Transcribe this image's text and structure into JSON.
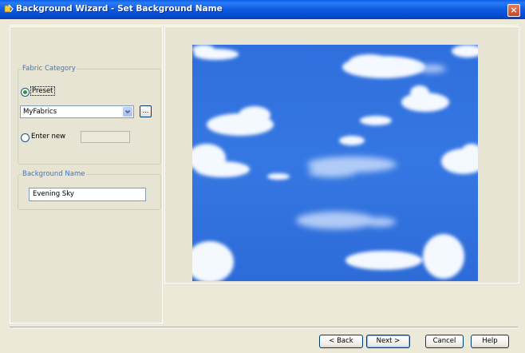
{
  "window": {
    "title": "Background Wizard - Set Background Name",
    "close_label": "×"
  },
  "fabric_category": {
    "legend": "Fabric Category",
    "preset_label": "Preset",
    "preset_selected": true,
    "preset_value": "MyFabrics",
    "browse_label": "...",
    "enter_new_label": "Enter new",
    "enter_new_value": ""
  },
  "background_name": {
    "legend": "Background Name",
    "value": "Evening Sky"
  },
  "preview": {
    "description_icon": "sky-clouds-preview"
  },
  "buttons": {
    "back": "< Back",
    "next": "Next >",
    "cancel": "Cancel",
    "help": "Help"
  },
  "colors": {
    "title_bar": "#0a5ee8",
    "group_legend": "#3f74c7",
    "sky": "#2f6fdd"
  }
}
